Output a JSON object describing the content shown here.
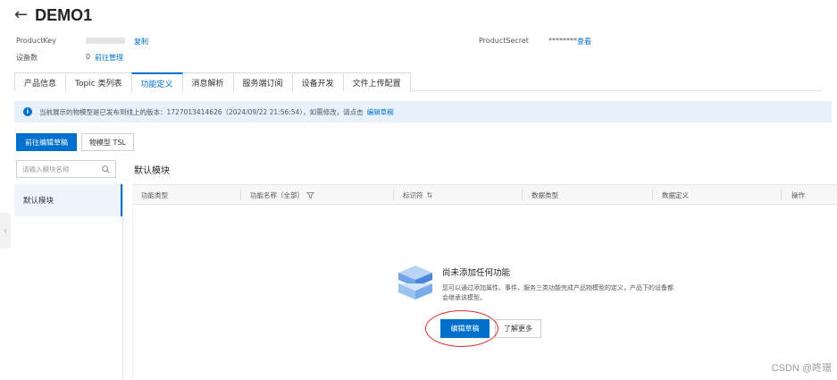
{
  "header": {
    "back_icon": "arrow-left-icon",
    "title": "DEMO1"
  },
  "meta": {
    "product_key_label": "ProductKey",
    "copy_link": "复制",
    "product_secret_label": "ProductSecret",
    "product_secret_value": "********",
    "view_link": "查看",
    "device_count_label": "设备数",
    "device_count_value": "0",
    "manage_link": "前往管理"
  },
  "tabs": [
    {
      "label": "产品信息"
    },
    {
      "label": "Topic 类列表"
    },
    {
      "label": "功能定义"
    },
    {
      "label": "消息解析"
    },
    {
      "label": "服务端订阅"
    },
    {
      "label": "设备开发"
    },
    {
      "label": "文件上传配置"
    }
  ],
  "notice": {
    "icon": "info-icon",
    "text": "当前展示的物模型是已发布到线上的版本：1727013414626（2024/09/22 21:56:54），如需修改，请点击",
    "link": "编辑草稿"
  },
  "toolbar": {
    "edit_draft_btn": "前往编辑草稿",
    "tsl_btn": "物模型 TSL"
  },
  "search": {
    "placeholder": "请输入模块名称",
    "icon": "search-icon"
  },
  "modules": [
    {
      "label": "默认模块"
    }
  ],
  "section_title": "默认模块",
  "table": {
    "columns": [
      "功能类型",
      "功能名称（全部）",
      "标识符",
      "数据类型",
      "数据定义",
      "操作"
    ]
  },
  "empty": {
    "title": "尚未添加任何功能",
    "desc": "您可以通过添加属性、事件、服务三类功能完成产品物模型的定义，产品下的设备都会继承该模型。",
    "edit_btn": "编辑草稿",
    "learn_btn": "了解更多"
  },
  "watermark": "CSDN @咚璟",
  "colors": {
    "accent": "#0070cc",
    "highlight_circle": "#d93030"
  }
}
